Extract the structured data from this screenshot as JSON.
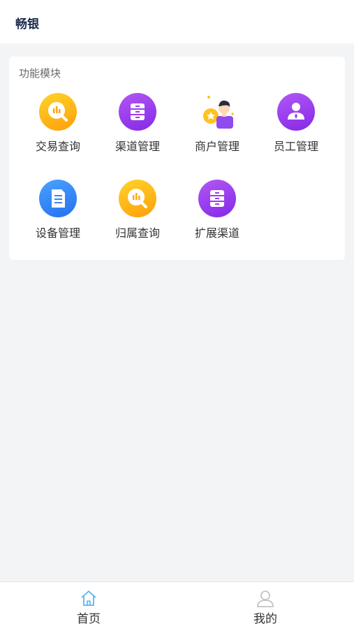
{
  "header": {
    "title": "畅银"
  },
  "functions": {
    "section_title": "功能模块",
    "items": [
      {
        "label": "交易查询",
        "icon": "chart-search-icon",
        "color": "#ffb11a"
      },
      {
        "label": "渠道管理",
        "icon": "drawer-icon",
        "color": "#9c3ef0"
      },
      {
        "label": "商户管理",
        "icon": "merchant-person-icon",
        "color": "#7c3aed"
      },
      {
        "label": "员工管理",
        "icon": "employee-icon",
        "color": "#9c3ef0"
      },
      {
        "label": "设备管理",
        "icon": "document-icon",
        "color": "#3a8bf8"
      },
      {
        "label": "归属查询",
        "icon": "chart-search-icon",
        "color": "#ffb11a"
      },
      {
        "label": "扩展渠道",
        "icon": "drawer-icon",
        "color": "#9c3ef0"
      }
    ]
  },
  "tabbar": {
    "items": [
      {
        "label": "首页",
        "icon": "home-icon",
        "active": true
      },
      {
        "label": "我的",
        "icon": "user-icon",
        "active": false
      }
    ]
  },
  "colors": {
    "accent": "#56b6f0",
    "background": "#f3f4f6",
    "card": "#ffffff"
  }
}
